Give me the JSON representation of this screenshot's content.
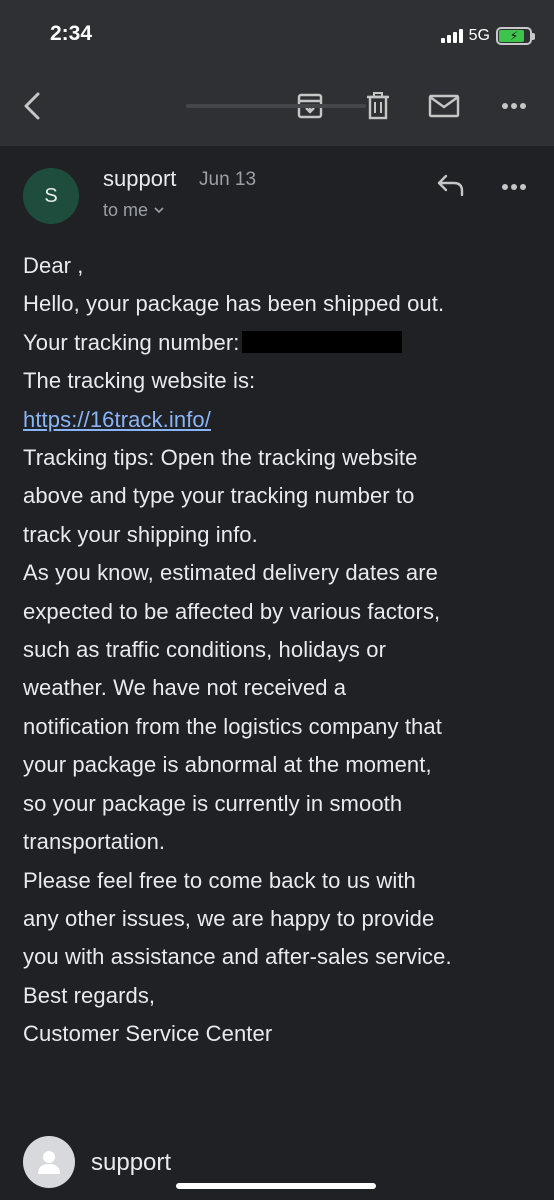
{
  "status_bar": {
    "time": "2:34",
    "network": "5G",
    "signal_bars": 4,
    "battery_level_fraction": 0.75,
    "battery_charging": true,
    "battery_color": "#3ec44a"
  },
  "toolbar": {
    "icons": [
      "back-arrow-icon",
      "archive-icon",
      "delete-icon",
      "mark-unread-icon",
      "more-options-icon"
    ]
  },
  "sender": {
    "avatar_letter": "S",
    "avatar_color": "#1e4d3d",
    "name": "support",
    "date": "Jun 13",
    "recipient": "to me"
  },
  "message": {
    "greeting": "Dear ,",
    "line_shipped": "Hello, your package has been shipped out.",
    "tracking_label": "Your tracking number:",
    "website_label": "The tracking website is:",
    "website_link": "https://16track.info/",
    "tips": [
      "Tracking tips: Open the tracking website",
      "above and type your tracking number to",
      "track your shipping info."
    ],
    "delivery": [
      "As you know, estimated delivery dates are",
      "expected to be affected by various factors,",
      "such as traffic conditions, holidays or",
      "weather. We have not received a",
      "notification from the logistics company that",
      "your package is abnormal at the moment,",
      "so your package is currently in smooth",
      "transportation."
    ],
    "closing": [
      "Please feel free to come back to us with",
      "any other issues, we are happy to provide",
      "you with assistance and after-sales service.",
      "Best regards,",
      "Customer Service Center"
    ],
    "link_color": "#8ab4f8"
  },
  "footer": {
    "name": "support"
  },
  "colors": {
    "background": "#202124",
    "toolbar": "#2f3033",
    "text": "#e8eaed",
    "muted": "#9aa0a6"
  }
}
